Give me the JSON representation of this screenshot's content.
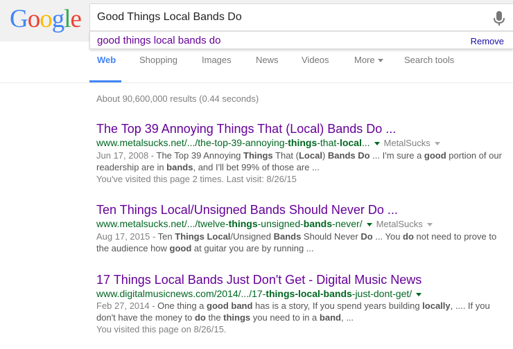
{
  "search": {
    "query": "Good Things Local Bands Do",
    "suggestion": "good things local bands do",
    "remove_label": "Remove"
  },
  "logo": {
    "letters": [
      "G",
      "o",
      "o",
      "g",
      "l",
      "e"
    ]
  },
  "colors": {
    "blue": "#4285f4",
    "red": "#ea4335",
    "yellow": "#fbbc05",
    "green": "#34a853",
    "visited": "#660099",
    "url": "#006621"
  },
  "tabs": [
    {
      "label": "Web"
    },
    {
      "label": "Shopping"
    },
    {
      "label": "Images"
    },
    {
      "label": "News"
    },
    {
      "label": "Videos"
    },
    {
      "label": "More"
    },
    {
      "label": "Search tools"
    }
  ],
  "stats": "About 90,600,000 results (0.44 seconds)",
  "results": [
    {
      "title": "The Top 39 Annoying Things That (Local) Bands Do ...",
      "url_pre": "www.metalsucks.net/.../the-top-39-annoying-",
      "url_bold1": "things",
      "url_mid": "-that-",
      "url_bold2": "local",
      "url_post": "...",
      "site": "MetalSucks",
      "date": "Jun 17, 2008 - ",
      "s1": "The Top 39 Annoying ",
      "b1": "Things",
      "s2": " That (",
      "b2": "Local",
      "s3": ") ",
      "b3": "Bands Do",
      "s4": " ... I'm sure a ",
      "b4": "good",
      "s5": " portion of our readership are in ",
      "b5": "bands",
      "s6": ", and I'll bet 99% of those are  ...",
      "visited": "You've visited this page 2 times. Last visit: 8/26/15"
    },
    {
      "title": "Ten Things Local/Unsigned Bands Should Never Do ...",
      "url_pre": "www.metalsucks.net/.../twelve-",
      "url_bold1": "things",
      "url_mid": "-unsigned-",
      "url_bold2": "bands",
      "url_post": "-never/",
      "site": "MetalSucks",
      "date": "Aug 17, 2015 - ",
      "s1": "Ten ",
      "b1": "Things Local",
      "s2": "/Unsigned ",
      "b2": "Bands",
      "s3": " Should Never ",
      "b3": "Do",
      "s4": " ... You ",
      "b4": "do",
      "s5": " not need to prove to the audience how ",
      "b5": "good",
      "s6": " at guitar you are by running  ..."
    },
    {
      "title": "17 Things Local Bands Just Don't Get - Digital Music News",
      "url_pre": "www.digitalmusicnews.com/2014/.../17-",
      "url_bold1": "things-local-bands",
      "url_mid": "-just-dont-get/",
      "date": "Feb 27, 2014 - ",
      "s1": "One thing a ",
      "b1": "good band",
      "s2": " has is a story, If you spend years building ",
      "b2": "locally",
      "s3": ", .... If you don't have the money to ",
      "b3": "do",
      "s4": " the ",
      "b4": "things",
      "s5": " you need to in a ",
      "b5": "band",
      "s6": ",  ...",
      "visited": "You visited this page on 8/26/15."
    }
  ]
}
